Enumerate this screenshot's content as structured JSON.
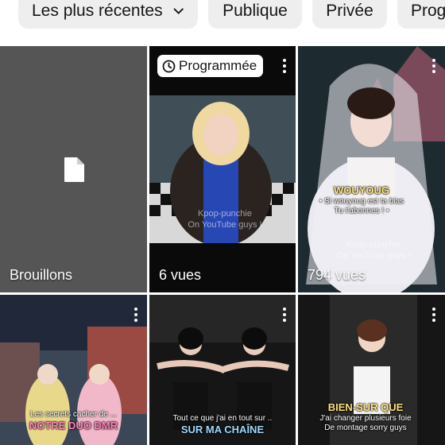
{
  "filters": {
    "sort_label": "Les plus récentes",
    "public_label": "Publique",
    "private_label": "Privée",
    "partial_label": "Prog"
  },
  "tiles": [
    {
      "label": "Brouillons",
      "icon": "document-icon"
    },
    {
      "badge": "Programmée",
      "label": "6 vues",
      "watermark": "Kpop-punchie\nOn YouTube guys !"
    },
    {
      "label": "794 vues",
      "overlay_title": "WOUYOUG",
      "overlay_line1": "• Si wouyoug est ta bias",
      "overlay_line2": "Tu t'abonnes ! •",
      "watermark": "Kpop-punchie\nOn YouTube guys !"
    },
    {
      "overlay_line1": "Les secrets cacher de ...",
      "overlay_title": "NOTRE DUO DMR"
    },
    {
      "overlay_line1": "Tout ce que j'ai en tout sur ..",
      "overlay_title": "SUR MA CHAÎNE"
    },
    {
      "overlay_title": "BIEN-SUR QUE",
      "overlay_line1": "J'ai changer plusieurs foie",
      "overlay_line2": "De montage sorry guys"
    }
  ],
  "colors": {
    "chip_bg": "#eeeeee",
    "text": "#161616",
    "overlay_accent": "#ffe27a",
    "pink_accent": "#ff7fb8"
  }
}
